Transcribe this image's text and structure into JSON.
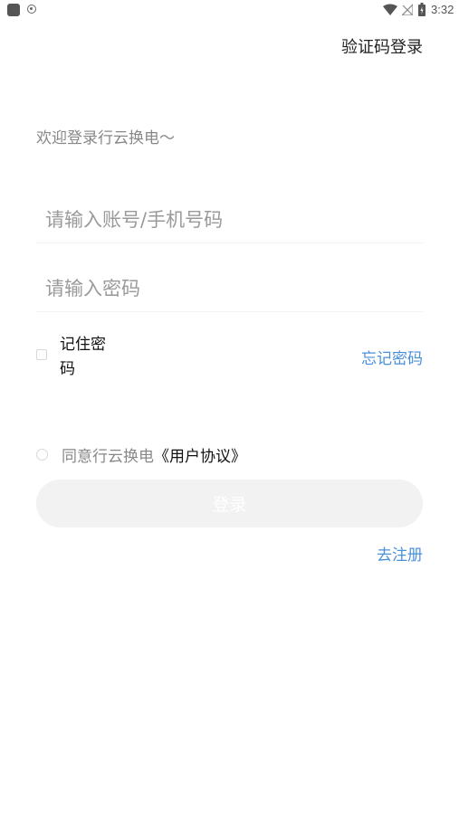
{
  "status_bar": {
    "time": "3:32",
    "icons": [
      "app-icon",
      "eye-icon",
      "wifi-icon",
      "no-signal-icon",
      "battery-icon"
    ]
  },
  "header": {
    "sms_login_label": "验证码登录"
  },
  "welcome_text": "欢迎登录行云换电～",
  "form": {
    "account_placeholder": "请输入账号/手机号码",
    "account_value": "",
    "password_placeholder": "请输入密码",
    "password_value": "",
    "remember_label": "记住密码",
    "remember_checked": false,
    "forgot_label": "忘记密码",
    "agree_prefix": "同意行云换电",
    "agree_link": "《用户协议》",
    "agree_checked": false,
    "login_label": "登录",
    "register_label": "去注册"
  },
  "colors": {
    "link": "#4a90d9",
    "button_bg": "#f2f2f2",
    "placeholder": "#9a9a9a"
  }
}
